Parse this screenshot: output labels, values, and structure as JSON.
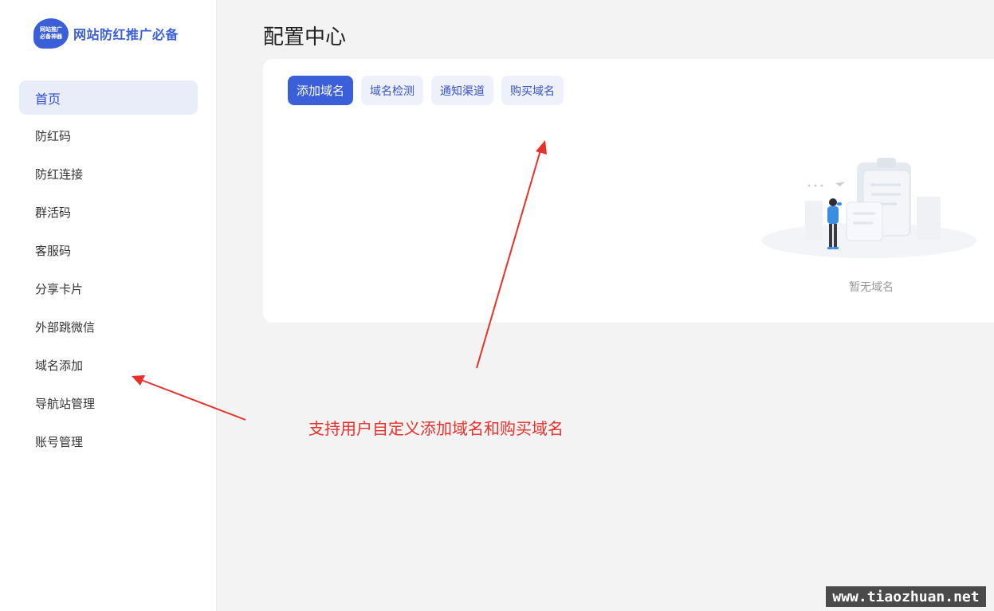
{
  "sidebar": {
    "logo_badge_line1": "网站推广",
    "logo_badge_line2": "必备神器",
    "logo_text": "网站防红推广必备",
    "items": [
      {
        "label": "首页",
        "active": true
      },
      {
        "label": "防红码"
      },
      {
        "label": "防红连接"
      },
      {
        "label": "群活码"
      },
      {
        "label": "客服码"
      },
      {
        "label": "分享卡片"
      },
      {
        "label": "外部跳微信"
      },
      {
        "label": "域名添加"
      },
      {
        "label": "导航站管理"
      },
      {
        "label": "账号管理"
      }
    ]
  },
  "main": {
    "title": "配置中心",
    "tabs": [
      {
        "label": "添加域名",
        "active": true
      },
      {
        "label": "域名检测"
      },
      {
        "label": "通知渠道"
      },
      {
        "label": "购买域名"
      }
    ],
    "empty_text": "暂无域名"
  },
  "annotation": {
    "text": "支持用户自定义添加域名和购买域名",
    "color": "#e8302c"
  },
  "watermark": "www.tiaozhuan.net",
  "colors": {
    "accent": "#3b5fd9",
    "sidebar_active_bg": "#e9ecf9",
    "page_bg": "#f2f3f2"
  }
}
